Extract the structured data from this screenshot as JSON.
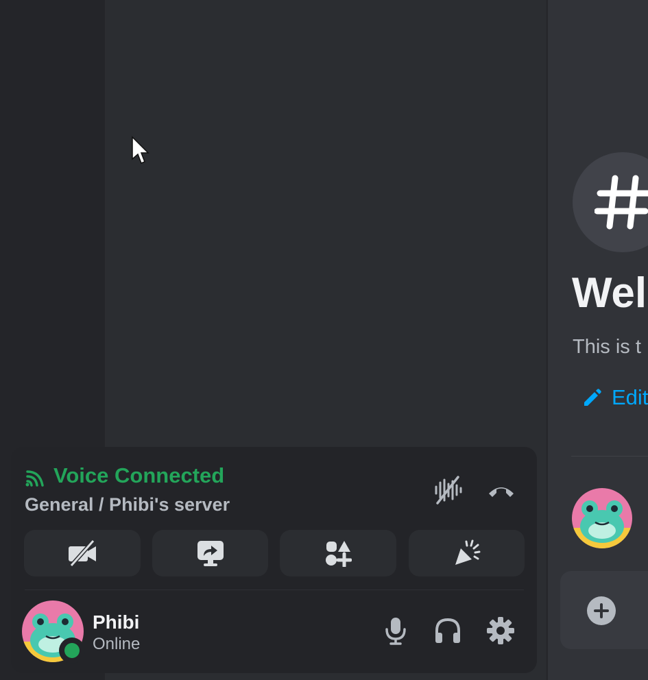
{
  "voice": {
    "title": "Voice Connected",
    "channel": "General / Phibi's server",
    "signal_icon": "signal-bars-icon",
    "noise_icon": "noise-suppression-icon",
    "disconnect_icon": "phone-hangup-icon",
    "actions": [
      {
        "icon": "camera-off-icon"
      },
      {
        "icon": "screen-share-icon"
      },
      {
        "icon": "activities-icon"
      },
      {
        "icon": "soundboard-icon"
      }
    ]
  },
  "user": {
    "name": "Phibi",
    "status": "Online",
    "status_color": "#23a55a",
    "mic_icon": "microphone-icon",
    "headset_icon": "headphones-icon",
    "settings_icon": "gear-icon"
  },
  "chat": {
    "hash_symbol": "#",
    "welcome_title": "Wel",
    "welcome_sub": "This is t",
    "edit_link": "Edit"
  },
  "colors": {
    "accent_green": "#23a55a",
    "link_blue": "#00a8fc"
  }
}
